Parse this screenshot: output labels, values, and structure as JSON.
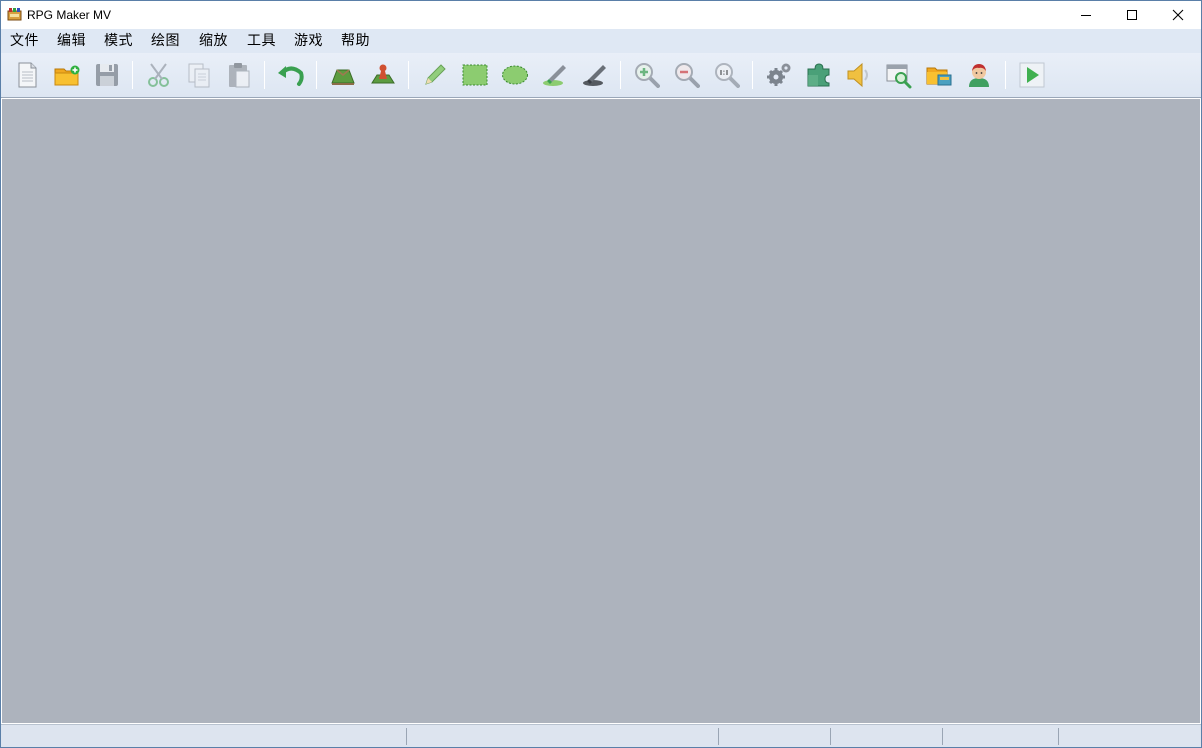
{
  "window": {
    "title": "RPG Maker MV",
    "app_icon": "rpg-maker-icon",
    "controls": {
      "minimize": "minimize-icon",
      "maximize": "maximize-icon",
      "close": "close-icon"
    }
  },
  "menubar": {
    "items": [
      "文件",
      "编辑",
      "模式",
      "绘图",
      "缩放",
      "工具",
      "游戏",
      "帮助"
    ]
  },
  "toolbar": {
    "buttons": [
      {
        "name": "new-project",
        "icon": "new-document-icon"
      },
      {
        "name": "open-project",
        "icon": "open-folder-icon"
      },
      {
        "name": "save-project",
        "icon": "save-disk-icon"
      },
      {
        "name": "cut",
        "icon": "scissors-icon"
      },
      {
        "name": "copy",
        "icon": "copy-icon"
      },
      {
        "name": "paste",
        "icon": "paste-icon"
      },
      {
        "name": "undo",
        "icon": "undo-icon"
      },
      {
        "name": "map-mode",
        "icon": "map-icon"
      },
      {
        "name": "event-mode",
        "icon": "event-icon"
      },
      {
        "name": "pencil",
        "icon": "pencil-icon"
      },
      {
        "name": "rectangle",
        "icon": "rectangle-icon"
      },
      {
        "name": "ellipse",
        "icon": "ellipse-icon"
      },
      {
        "name": "flood-fill",
        "icon": "fill-icon"
      },
      {
        "name": "shadow-pen",
        "icon": "shadow-pen-icon"
      },
      {
        "name": "zoom-in",
        "icon": "zoom-in-icon"
      },
      {
        "name": "zoom-out",
        "icon": "zoom-out-icon"
      },
      {
        "name": "zoom-actual",
        "icon": "zoom-actual-icon"
      },
      {
        "name": "database",
        "icon": "gears-icon"
      },
      {
        "name": "plugin-manager",
        "icon": "puzzle-icon"
      },
      {
        "name": "sound-test",
        "icon": "speaker-icon"
      },
      {
        "name": "event-searcher",
        "icon": "search-window-icon"
      },
      {
        "name": "resource-manager",
        "icon": "resource-folder-icon"
      },
      {
        "name": "character-generator",
        "icon": "character-icon"
      },
      {
        "name": "playtest",
        "icon": "play-icon"
      }
    ]
  },
  "colors": {
    "canvas": "#adb3bd",
    "menubar": "#dfe8f4",
    "toolbar": "#e3eaf5",
    "statusbar": "#dde4ef"
  }
}
